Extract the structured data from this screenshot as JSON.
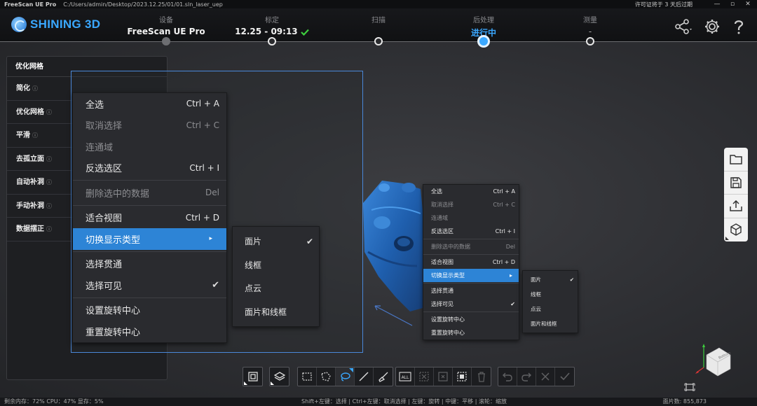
{
  "titlebar": {
    "app": "FreeScan UE Pro",
    "path": "C:/Users/admin/Desktop/2023.12.25/01/01.sln_laser_uep",
    "license": "许可证将于 3 天后过期",
    "min": "—",
    "max": "▫",
    "close": "✕"
  },
  "header": {
    "brand": "SHINING 3D",
    "steps": [
      {
        "label": "设备",
        "value": "FreeScan UE Pro"
      },
      {
        "label": "标定",
        "value": "12.25 - 09:13"
      },
      {
        "label": "扫描",
        "value": ""
      },
      {
        "label": "后处理",
        "value": "进行中"
      },
      {
        "label": "测量",
        "value": "-"
      }
    ]
  },
  "left_panel": {
    "title": "优化网格",
    "items": [
      {
        "label": "简化",
        "info": "ⓘ"
      },
      {
        "label": "优化网格",
        "info": "ⓘ"
      },
      {
        "label": "平滑",
        "info": "ⓘ"
      },
      {
        "label": "去孤立面",
        "info": "ⓘ"
      },
      {
        "label": "自动补洞",
        "info": "ⓘ"
      },
      {
        "label": "手动补洞",
        "info": "ⓘ"
      },
      {
        "label": "数据摆正",
        "info": "ⓘ"
      }
    ]
  },
  "context_menu": {
    "select_all": {
      "label": "全选",
      "shortcut": "Ctrl + A"
    },
    "deselect": {
      "label": "取消选择",
      "shortcut": "Ctrl + C"
    },
    "connected": {
      "label": "连通域"
    },
    "invert": {
      "label": "反选选区",
      "shortcut": "Ctrl + I"
    },
    "delete": {
      "label": "删除选中的数据",
      "shortcut": "Del"
    },
    "fit_view": {
      "label": "适合视图",
      "shortcut": "Ctrl + D"
    },
    "switch_display": {
      "label": "切换显示类型",
      "arrow": "▸"
    },
    "select_through": {
      "label": "选择贯通"
    },
    "select_visible": {
      "label": "选择可见",
      "check": "✔"
    },
    "set_rotation": {
      "label": "设置旋转中心"
    },
    "reset_rotation": {
      "label": "重置旋转中心"
    }
  },
  "display_submenu": {
    "faces": {
      "label": "面片",
      "check": "✔"
    },
    "wireframe": {
      "label": "线框"
    },
    "pointcloud": {
      "label": "点云"
    },
    "faces_wire": {
      "label": "面片和线框"
    }
  },
  "viewcube_label": "Bottom",
  "statusbar": {
    "left": "剩余内存：72%  CPU：47%  显存：5%",
    "center": "Shift+左键：选择 | Ctrl+左键：取消选择 | 左键：旋转 | 中键：平移 | 滚轮：缩放",
    "right": "面片数: 855,873"
  },
  "colors": {
    "accent": "#3aa8ff",
    "highlight": "#2d84d6",
    "model": "#1f5fae"
  }
}
